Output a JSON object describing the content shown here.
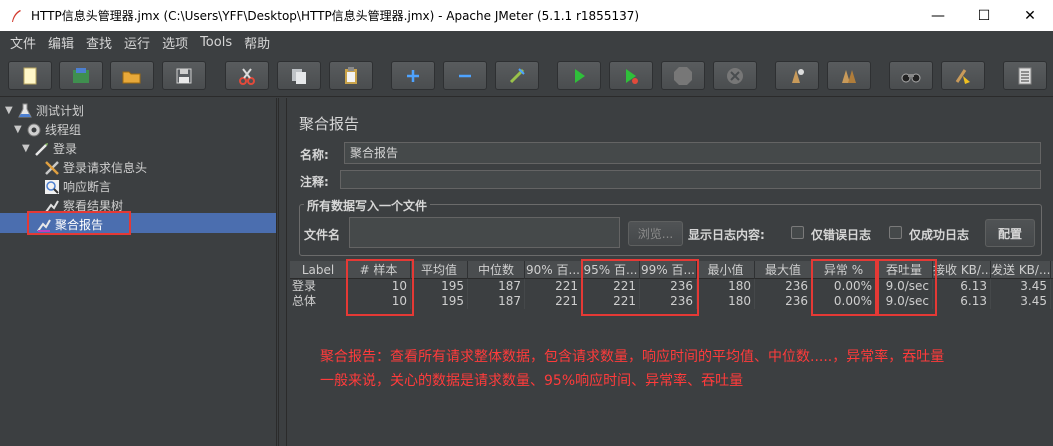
{
  "window": {
    "title": "HTTP信息头管理器.jmx (C:\\Users\\YFF\\Desktop\\HTTP信息头管理器.jmx) - Apache JMeter (5.1.1 r1855137)",
    "minimize": "—",
    "maximize": "☐",
    "close": "✕"
  },
  "menu": [
    "文件",
    "编辑",
    "查找",
    "运行",
    "选项",
    "Tools",
    "帮助"
  ],
  "toolbar": {
    "items": [
      "new-icon",
      "templates-icon",
      "open-icon",
      "save-icon",
      "cut-icon",
      "copy-icon",
      "paste-icon",
      "expand-icon",
      "collapse-icon",
      "toggle-icon",
      "start-icon",
      "start-no-pause-icon",
      "stop-icon",
      "shutdown-icon",
      "clear-icon",
      "clear-all-icon",
      "search-icon",
      "reset-search-icon",
      "function-helper-icon"
    ],
    "accent": "#4ea3ff",
    "run_color": "#2fbf3a"
  },
  "tree": {
    "items": [
      {
        "label": "测试计划",
        "icon": "flask-icon",
        "level": 0,
        "expanded": true
      },
      {
        "label": "线程组",
        "icon": "gear-icon",
        "level": 1,
        "expanded": true
      },
      {
        "label": "登录",
        "icon": "pen-icon",
        "level": 2,
        "expanded": true
      },
      {
        "label": "登录请求信息头",
        "icon": "wrench-icon",
        "level": 3
      },
      {
        "label": "响应断言",
        "icon": "magnifier-icon",
        "level": 3
      },
      {
        "label": "察看结果树",
        "icon": "chart-icon",
        "level": 3
      },
      {
        "label": "聚合报告",
        "icon": "chart-icon",
        "level": 3,
        "selected": true
      }
    ]
  },
  "panel": {
    "title": "聚合报告",
    "name_label": "名称:",
    "name_value": "聚合报告",
    "comment_label": "注释:",
    "comment_value": "",
    "group_title": "所有数据写入一个文件",
    "filename_label": "文件名",
    "filename_value": "",
    "browse_button": "浏览...",
    "log_label": "显示日志内容:",
    "errors_only": "仅错误日志",
    "success_only": "仅成功日志",
    "configure_button": "配置"
  },
  "table": {
    "headers": [
      "Label",
      "# 样本",
      "平均值",
      "中位数",
      "90% 百...",
      "95% 百...",
      "99% 百...",
      "最小值",
      "最大值",
      "异常 %",
      "吞吐量",
      "接收 KB/...",
      "发送 KB/..."
    ],
    "rows": [
      [
        "登录",
        "10",
        "195",
        "187",
        "221",
        "221",
        "236",
        "180",
        "236",
        "0.00%",
        "9.0/sec",
        "6.13",
        "3.45"
      ],
      [
        "总体",
        "10",
        "195",
        "187",
        "221",
        "221",
        "236",
        "180",
        "236",
        "0.00%",
        "9.0/sec",
        "6.13",
        "3.45"
      ]
    ]
  },
  "annotation": {
    "line1": "聚合报告：查看所有请求整体数据，包含请求数量，响应时间的平均值、中位数.....，异常率，吞吐量",
    "line2": "一般来说，关心的数据是请求数量、95%响应时间、异常率、吞吐量",
    "color": "#ff3b3b"
  }
}
